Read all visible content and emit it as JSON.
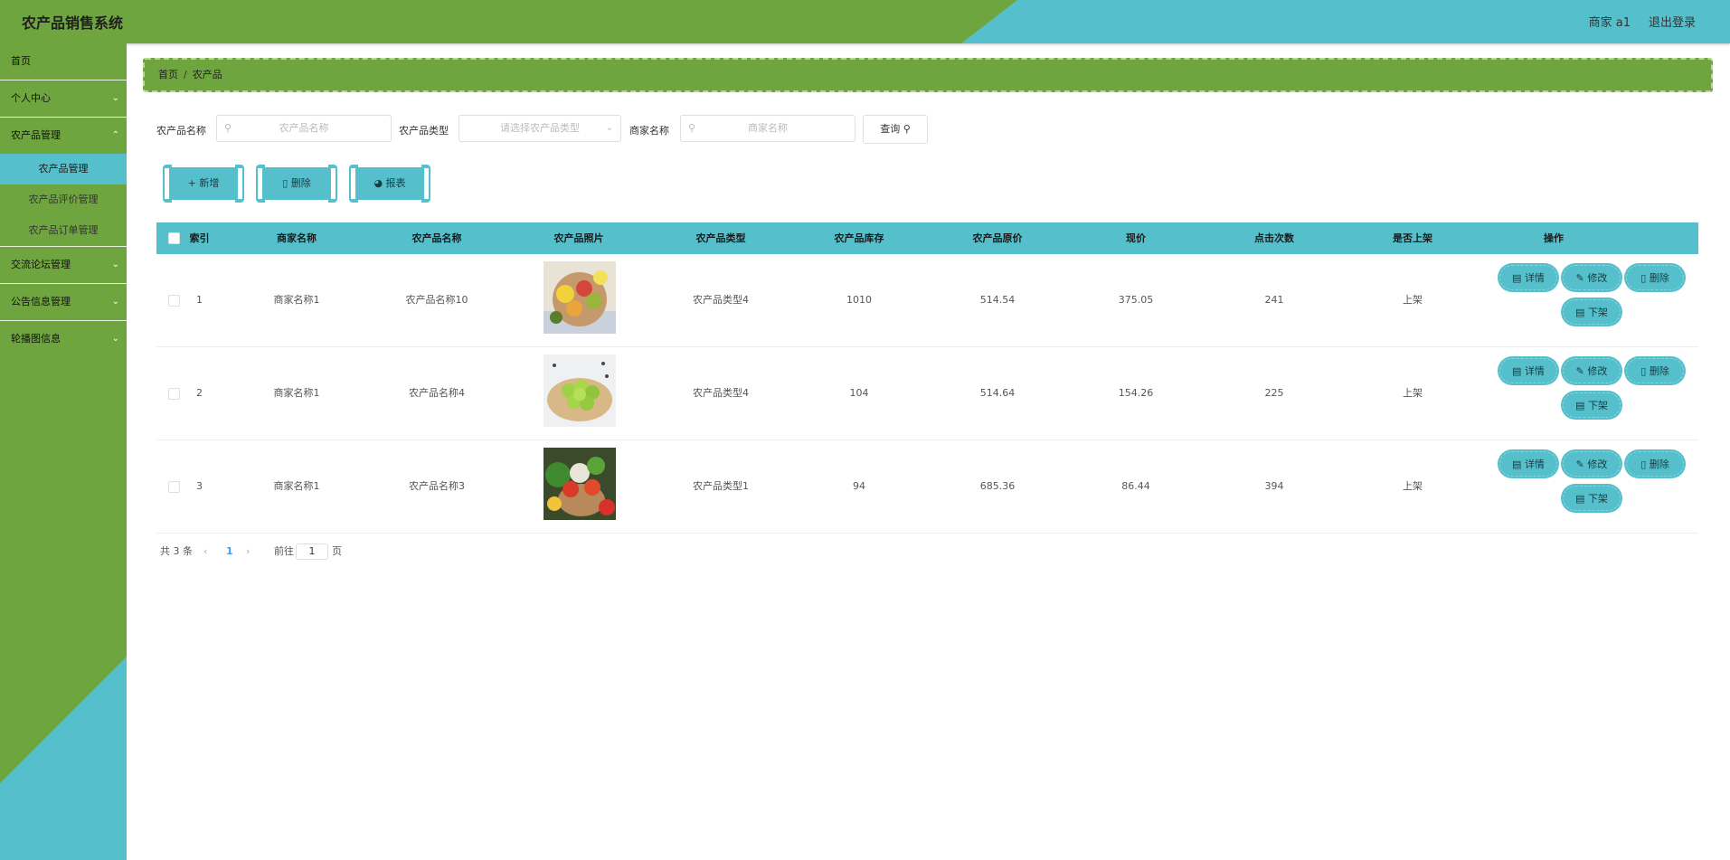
{
  "header": {
    "title": "农产品销售系统",
    "user": "商家 a1",
    "logout": "退出登录"
  },
  "sidebar": {
    "items": [
      {
        "label": "首页"
      },
      {
        "label": "个人中心"
      },
      {
        "label": "农产品管理"
      },
      {
        "label": "交流论坛管理"
      },
      {
        "label": "公告信息管理"
      },
      {
        "label": "轮播图信息"
      }
    ],
    "submenu": [
      {
        "label": "农产品管理"
      },
      {
        "label": "农产品评价管理"
      },
      {
        "label": "农产品订单管理"
      }
    ]
  },
  "breadcrumb": {
    "home": "首页",
    "sep": "/",
    "current": "农产品"
  },
  "search": {
    "name_label": "农产品名称",
    "name_placeholder": "农产品名称",
    "type_label": "农产品类型",
    "type_placeholder": "请选择农产品类型",
    "merchant_label": "商家名称",
    "merchant_placeholder": "商家名称",
    "query": "查询"
  },
  "actions": {
    "add": "新增",
    "delete": "删除",
    "report": "报表"
  },
  "table": {
    "headers": [
      "索引",
      "商家名称",
      "农产品名称",
      "农产品照片",
      "农产品类型",
      "农产品库存",
      "农产品原价",
      "现价",
      "点击次数",
      "是否上架",
      "操作"
    ],
    "ops": {
      "detail": "详情",
      "edit": "修改",
      "delete": "删除",
      "off": "下架"
    },
    "rows": [
      {
        "index": "1",
        "merchant": "商家名称1",
        "name": "农产品名称10",
        "type": "农产品类型4",
        "stock": "1010",
        "orig": "514.54",
        "price": "375.05",
        "clicks": "241",
        "status": "上架"
      },
      {
        "index": "2",
        "merchant": "商家名称1",
        "name": "农产品名称4",
        "type": "农产品类型4",
        "stock": "104",
        "orig": "514.64",
        "price": "154.26",
        "clicks": "225",
        "status": "上架"
      },
      {
        "index": "3",
        "merchant": "商家名称1",
        "name": "农产品名称3",
        "type": "农产品类型1",
        "stock": "94",
        "orig": "685.36",
        "price": "86.44",
        "clicks": "394",
        "status": "上架"
      }
    ]
  },
  "pager": {
    "total": "共 3 条",
    "page": "1",
    "goto": "前往",
    "page_value": "1",
    "unit": "页"
  }
}
